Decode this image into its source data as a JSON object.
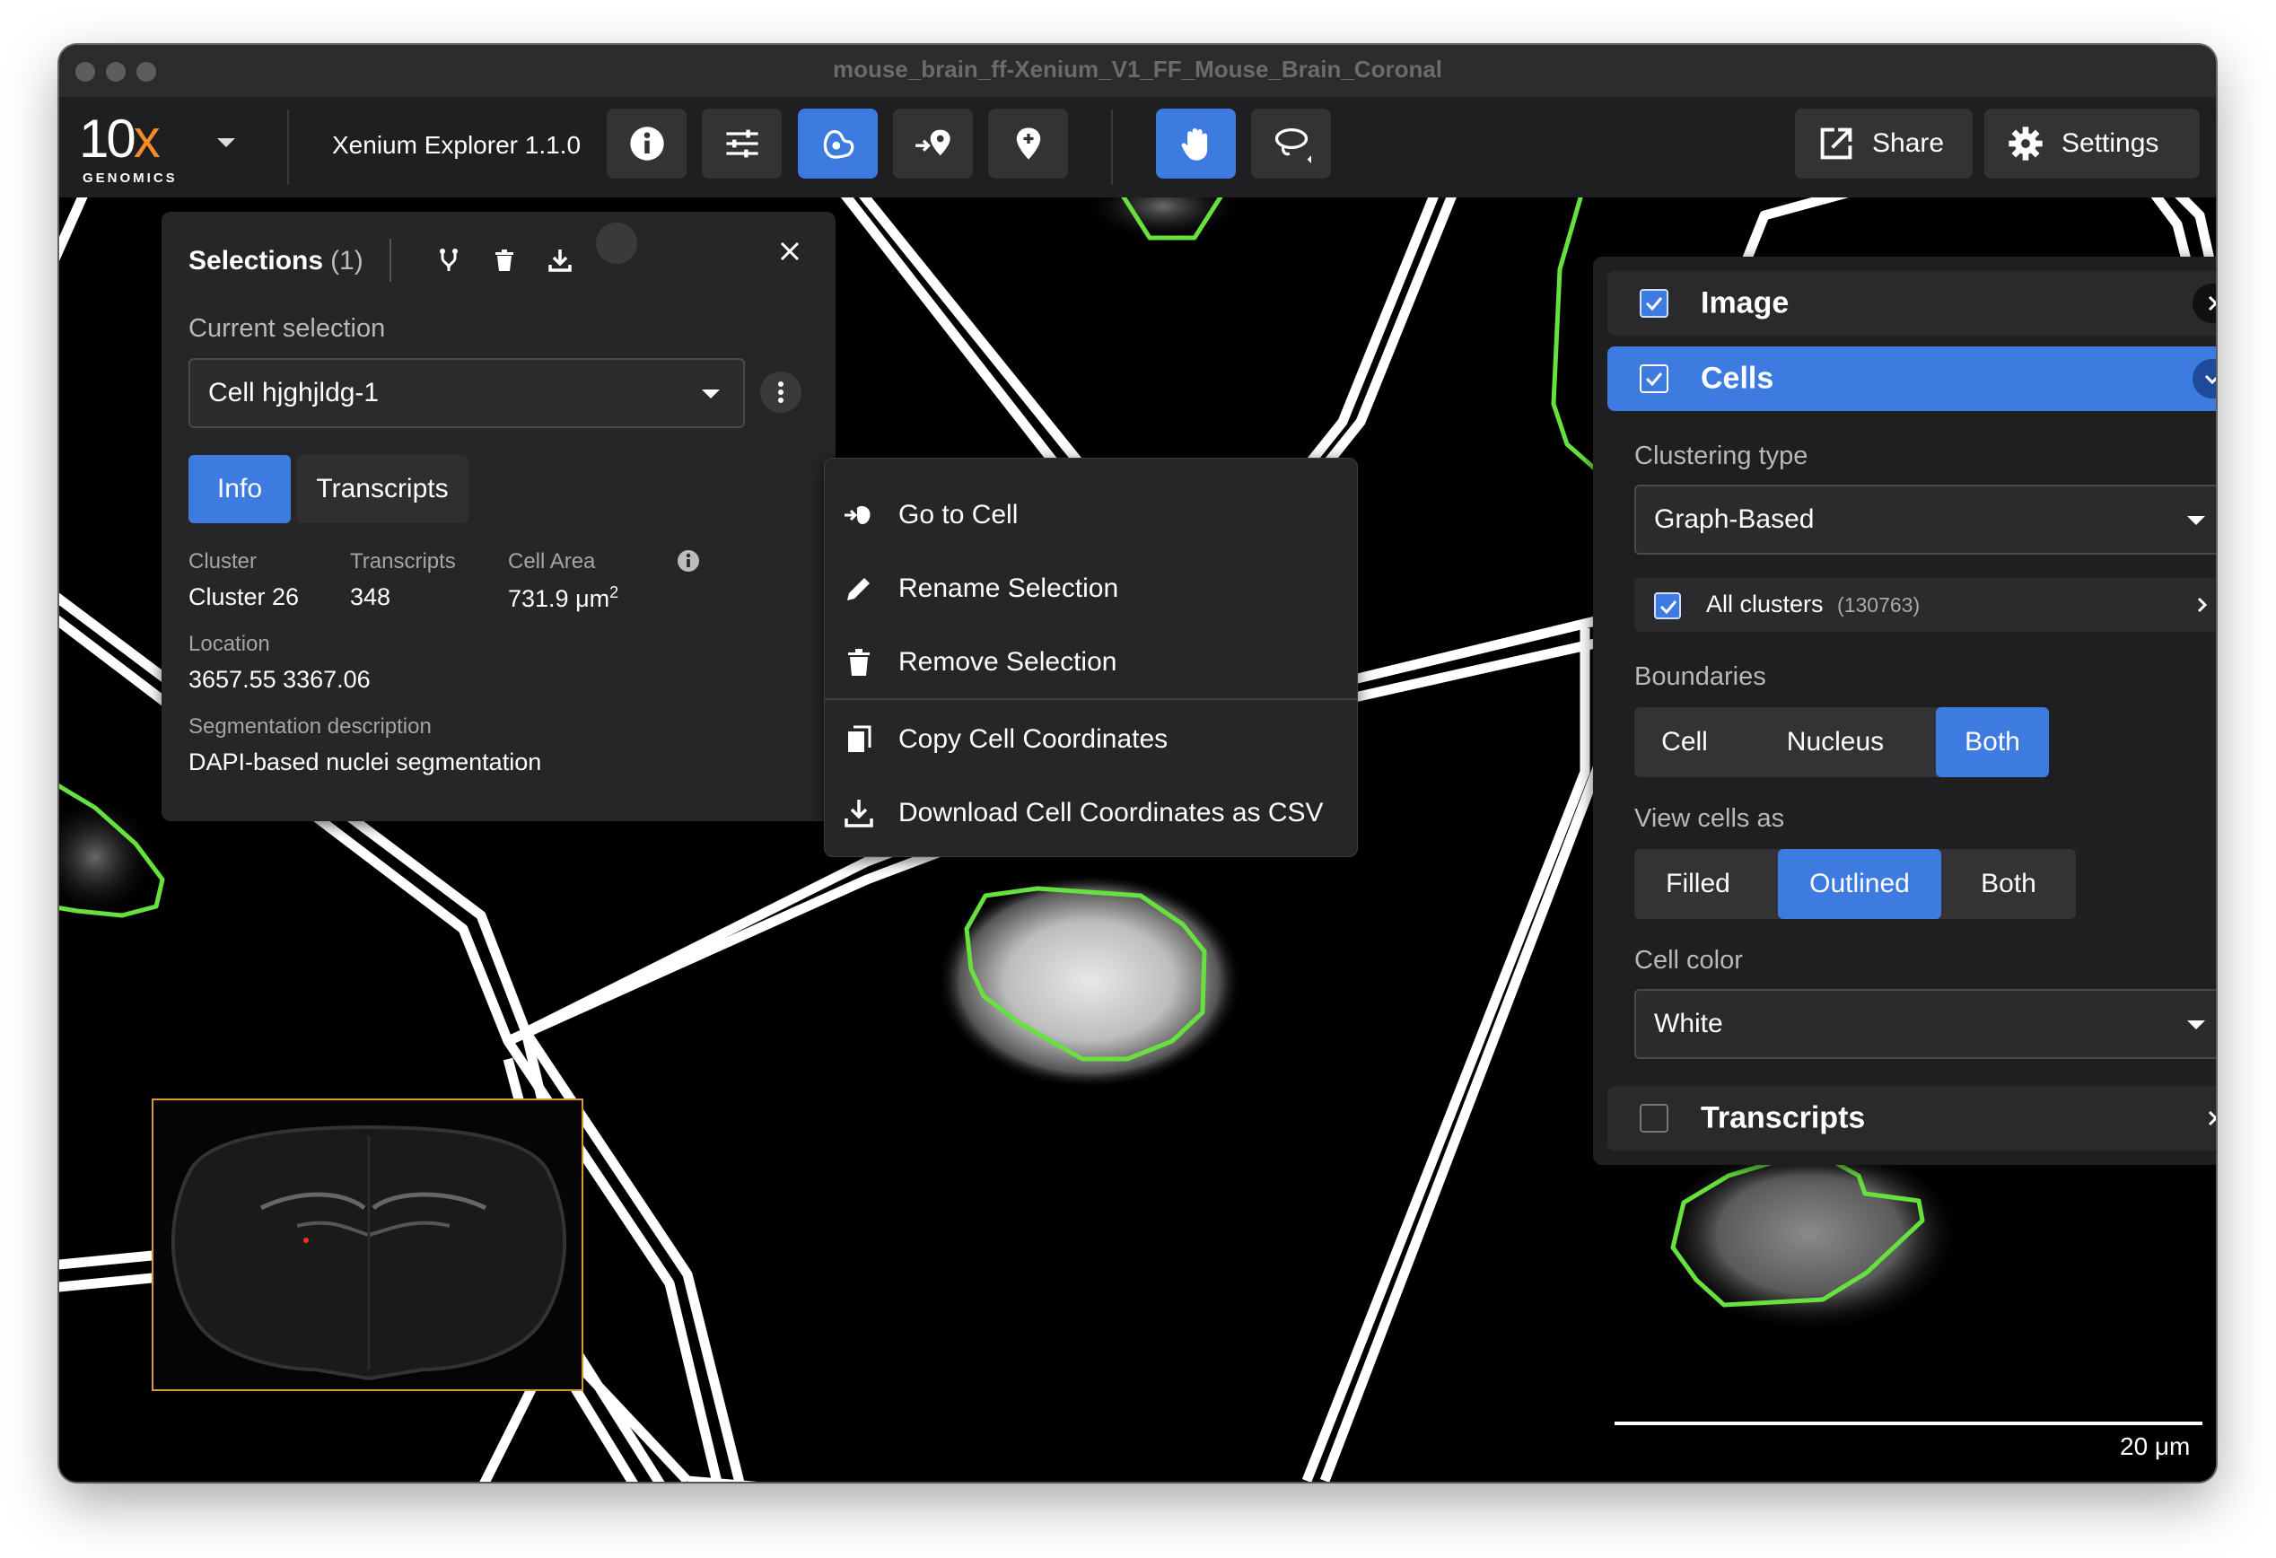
{
  "window": {
    "title": "mouse_brain_ff-Xenium_V1_FF_Mouse_Brain_Coronal"
  },
  "toolbar": {
    "logo_big": "10",
    "logo_x": "x",
    "logo_sub": "GENOMICS",
    "app_name": "Xenium Explorer 1.1.0",
    "share_label": "Share",
    "settings_label": "Settings"
  },
  "selections": {
    "title": "Selections",
    "count": "(1)",
    "current_selection_label": "Current selection",
    "current_selection_value": "Cell hjghjldg-1",
    "tabs": [
      {
        "label": "Info"
      },
      {
        "label": "Transcripts"
      }
    ],
    "active_tab": "Info",
    "cluster_label": "Cluster",
    "cluster_value": "Cluster 26",
    "transcripts_label": "Transcripts",
    "transcripts_value": "348",
    "cell_area_label": "Cell Area",
    "cell_area_value": "731.9 μm",
    "cell_area_sup": "2",
    "location_label": "Location",
    "location_value": "3657.55  3367.06",
    "segmentation_label": "Segmentation description",
    "segmentation_value": "DAPI-based nuclei segmentation"
  },
  "context_menu": {
    "items": [
      {
        "label": "Go to Cell",
        "icon": "go-to-icon"
      },
      {
        "label": "Rename Selection",
        "icon": "pencil-icon"
      },
      {
        "label": "Remove Selection",
        "icon": "trash-icon"
      },
      {
        "label": "Copy Cell Coordinates",
        "icon": "copy-icon"
      },
      {
        "label": "Download Cell Coordinates as CSV",
        "icon": "download-icon"
      }
    ]
  },
  "layers": {
    "image": {
      "label": "Image",
      "checked": true
    },
    "cells": {
      "label": "Cells",
      "checked": true,
      "clustering_type_label": "Clustering type",
      "clustering_type_value": "Graph-Based",
      "all_clusters_label": "All clusters",
      "all_clusters_count": "(130763)",
      "boundaries_label": "Boundaries",
      "boundaries_options": [
        "Cell",
        "Nucleus",
        "Both"
      ],
      "boundaries_selected": "Both",
      "view_cells_label": "View cells as",
      "view_cells_options": [
        "Filled",
        "Outlined",
        "Both"
      ],
      "view_cells_selected": "Outlined",
      "cell_color_label": "Cell color",
      "cell_color_value": "White"
    },
    "transcripts": {
      "label": "Transcripts",
      "checked": false
    }
  },
  "scale": {
    "label": "20  μm"
  },
  "colors": {
    "accent": "#3d7be0",
    "outline_green": "#67e13f",
    "minimap_border": "#d59a3a"
  }
}
